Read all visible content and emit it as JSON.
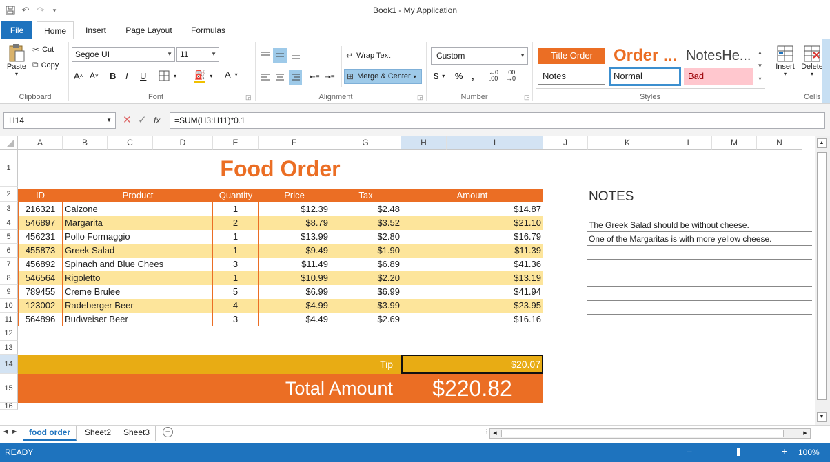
{
  "window": {
    "title": "Book1 - My Application"
  },
  "ribbon_tabs": [
    "File",
    "Home",
    "Insert",
    "Page Layout",
    "Formulas"
  ],
  "clipboard": {
    "paste": "Paste",
    "cut": "Cut",
    "copy": "Copy",
    "label": "Clipboard"
  },
  "font": {
    "name": "Segoe UI",
    "size": "11",
    "label": "Font"
  },
  "alignment": {
    "wrap": "Wrap Text",
    "merge": "Merge & Center",
    "label": "Alignment"
  },
  "number": {
    "format": "Custom",
    "label": "Number"
  },
  "styles": {
    "title_order": "Title Order",
    "order": "Order ...",
    "notes_he": "NotesHe...",
    "notes": "Notes",
    "normal": "Normal",
    "bad": "Bad",
    "label": "Styles"
  },
  "cells": {
    "insert": "Insert",
    "delete": "Delete",
    "label": "Cells"
  },
  "formula_bar": {
    "name_box": "H14",
    "fx": "fx",
    "formula": "=SUM(H3:H11)*0.1"
  },
  "columns": [
    "A",
    "B",
    "C",
    "D",
    "E",
    "F",
    "G",
    "H",
    "I",
    "J",
    "K",
    "L",
    "M",
    "N"
  ],
  "sheet": {
    "title": "Food Order",
    "headers": [
      "ID",
      "Product",
      "Quantity",
      "Price",
      "Tax",
      "Amount"
    ],
    "rows": [
      [
        "216321",
        "Calzone",
        "1",
        "$12.39",
        "$2.48",
        "$14.87"
      ],
      [
        "546897",
        "Margarita",
        "2",
        "$8.79",
        "$3.52",
        "$21.10"
      ],
      [
        "456231",
        "Pollo Formaggio",
        "1",
        "$13.99",
        "$2.80",
        "$16.79"
      ],
      [
        "455873",
        "Greek Salad",
        "1",
        "$9.49",
        "$1.90",
        "$11.39"
      ],
      [
        "456892",
        "Spinach and Blue Chees",
        "3",
        "$11.49",
        "$6.89",
        "$41.36"
      ],
      [
        "546564",
        "Rigoletto",
        "1",
        "$10.99",
        "$2.20",
        "$13.19"
      ],
      [
        "789455",
        "Creme Brulee",
        "5",
        "$6.99",
        "$6.99",
        "$41.94"
      ],
      [
        "123002",
        "Radeberger Beer",
        "4",
        "$4.99",
        "$3.99",
        "$23.95"
      ],
      [
        "564896",
        "Budweiser Beer",
        "3",
        "$4.49",
        "$2.69",
        "$16.16"
      ]
    ],
    "tip_label": "Tip",
    "tip_value": "$20.07",
    "total_label": "Total Amount",
    "total_value": "$220.82",
    "notes_title": "NOTES",
    "notes": [
      "The Greek Salad should be without cheese.",
      "One of the Margaritas is with more yellow cheese."
    ]
  },
  "sheet_tabs": [
    "food order",
    "Sheet2",
    "Sheet3"
  ],
  "status": {
    "text": "READY",
    "zoom": "100%"
  },
  "colors": {
    "accent": "#1e73be",
    "orange": "#eb6e24",
    "band": "#fde59b",
    "tip": "#e8ac14"
  }
}
